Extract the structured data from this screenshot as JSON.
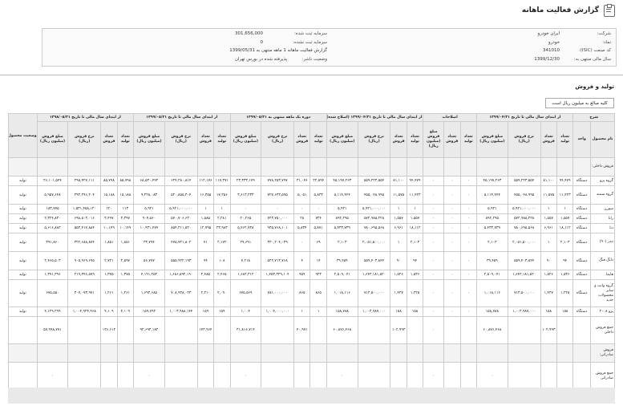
{
  "page": {
    "title": "گزارش فعالیت ماهانه"
  },
  "info": {
    "company_label": "شرکت:",
    "company_value": "ایران خودرو",
    "symbol_label": "نماد:",
    "symbol_value": "خودرو",
    "isic_label": "کد صنعت (ISIC):",
    "isic_value": "341010",
    "fiscal_label": "سال مالی منتهی به:",
    "fiscal_value": "1399/12/30",
    "reg_capital_label": "سرمایه ثبت شده:",
    "reg_capital_value": "301,656,000",
    "unreg_capital_label": "سرمایه ثبت نشده:",
    "unreg_capital_value": "0",
    "report_value": "گزارش فعالیت ماهانه 1 ماهه منتهی به 1399/05/31",
    "status_label": "وضعیت ناشر:",
    "status_value": "پذیرفته شده در بورس تهران"
  },
  "section": {
    "title": "تولید و فروش",
    "unit": "کلیه مبالغ به میلیون ریال است"
  },
  "table": {
    "group_headers": [
      "شرح",
      "از ابتدای سال مالی تا تاریخ ۱۳۹۹/۰۴/۳۱",
      "اصلاحات",
      "از ابتدای سال مالی تا تاریخ ۱۳۹۹/۰۴/۳۱ (اصلاح شده)",
      "دوره یک ماهه منتهی به ۱۳۹۹/۰۵/۳۱",
      "از ابتدای سال مالی تا تاریخ ۱۳۹۹/۰۵/۳۱",
      "از ابتدای سال مالی تا تاریخ ۱۳۹۸/۰۵/۳۱",
      "وضعیت محصول واحد"
    ],
    "sub_headers": [
      "نام محصول",
      "واحد",
      "تعداد تولید",
      "تعداد فروش",
      "نرخ فروش (ریال)",
      "مبلغ فروش (میلیون ریال)",
      "تعداد تولید",
      "تعداد فروش",
      "مبلغ فروش (میلیون ریال)",
      "تعداد تولید",
      "تعداد فروش",
      "نرخ فروش (ریال)",
      "مبلغ فروش (میلیون ریال)",
      "تعداد تولید",
      "تعداد فروش",
      "نرخ فروش (ریال)",
      "مبلغ فروش (میلیون ریال)",
      "تعداد تولید",
      "تعداد فروش",
      "نرخ فروش (ریال)",
      "مبلغ فروش (میلیون ریال)",
      "تعداد تولید",
      "تعداد فروش",
      "نرخ فروش (ریال)",
      "مبلغ فروش (میلیون ریال)",
      ""
    ],
    "rows": [
      {
        "kind": "sub",
        "h": 2,
        "cells": [
          "فروش داخلی:",
          "",
          "",
          "",
          "",
          "",
          "",
          "",
          "",
          "",
          "",
          "",
          "",
          "",
          "",
          "",
          "",
          "",
          "",
          "",
          "",
          "",
          "",
          "",
          "",
          ""
        ]
      },
      {
        "kind": "",
        "h": 1,
        "cells": [
          "گروه پژو",
          "دستگاه",
          "۹۴,۴۷۹",
          "۸۱,۱۰۰",
          "۵۵۹,۲۲۳,۵۵۴",
          "۴۵,۱۹۷,۲۶۳",
          "۰",
          "۰",
          "۰",
          "۹۴,۴۷۹",
          "۸۱,۱۰۰",
          "۵۵۹,۲۲۳,۵۵۴",
          "۴۵,۱۹۷,۲۶۳",
          "۲۲,۸۹۴",
          "۳۱,۰۷۶",
          "۷۷۸,۲۵۳,۷۹۷",
          "۲۳,۳۳۳,۱۷۹",
          "۱۱۷,۳۷۱",
          "۱۱۲,۱۷۶",
          "۶۲۴,۲۸۰,۸۱۴",
          "۶۸,۵۳۰,۴۴۲",
          "۸۵,۷۹۸",
          "۸۵,۷۹۸",
          "۲۹۵,۴۲۷,۱۱۱",
          "۲۶,۱۰۱,۵۴۴",
          "تولید"
        ]
      },
      {
        "kind": "",
        "h": 2,
        "cells": [
          "گروه سمند",
          "دستگاه",
          "۱۱,۴۲۳",
          "۱۱,۵۷۵",
          "۴۵۵,۰۴۸,۹۹۵",
          "۵,۱۱۴,۴۴۴",
          "۰",
          "۰",
          "۰",
          "۱۱,۴۲۳",
          "۱۱,۵۷۵",
          "۴۵۵,۰۴۸,۹۹۵",
          "۵,۱۱۴,۴۴۴",
          "۵,۸۳۳",
          "۵,۰۵۱",
          "۷۲۷,۶۳۲,۵۹۵",
          "۳,۶۱۳,۲۳۳",
          "۱۷,۲۵۶",
          "۱۶,۳۵۵",
          "۵۲۰,۸۵۵,۳۰۴",
          "۹,۲۲۸,۰۸۳",
          "۱۵,۱۸۸",
          "۱۵,۱۸۸",
          "۳۹۳,۲۹۶,۲۰۴",
          "۵,۹۵۷,۶۴۸",
          "تولید"
        ]
      },
      {
        "kind": "",
        "h": 1,
        "cells": [
          "سورن",
          "دستگاه",
          "۱",
          "۱",
          "۵,۹۲۱,۰۰۰,۰۰۰",
          "۵,۹۲۱",
          "۰",
          "۰",
          "۰",
          "۱",
          "۱",
          "۵,۹۲۱,۰۰۰,۰۰۰",
          "۵,۹۲۱",
          "۰",
          "۰",
          "۰",
          "۰",
          "۱",
          "۱",
          "۵,۹۲۱,۰۰۰,۰۰۰",
          "۵,۹۲۱",
          "۱۱۳",
          "۱۲۰",
          "۱,۵۳۱,۴۵۸,۱۲۰",
          "۱۸۳,۷۷۵",
          "تولید"
        ]
      },
      {
        "kind": "",
        "h": 1,
        "cells": [
          "رانا",
          "دستگاه",
          "۱,۵۵۷",
          "۱,۵۵۷",
          "۵۷۲,۹۸۵,۲۲۸",
          "۸۹۲,۲۹۵",
          "۰",
          "۰",
          "۰",
          "۱,۵۵۷",
          "۱,۵۵۷",
          "۵۷۲,۹۸۵,۲۲۸",
          "۸۹۲,۲۹۵",
          "۷۲۴",
          "۲۸",
          "۷۲۳,۷۵۰,۰۰۰",
          "۲۰,۲۶۵",
          "۲,۲۸۱",
          "۱,۵۸۵",
          "۵۷۰,۷۰۶,۶۳۰",
          "۹۰۴,۵۶۰",
          "۳,۳۹۷",
          "۳,۴۹۷",
          "۶۹۸,۵۰۳,۰۱۶",
          "۲,۳۲۴,۸۳۰",
          "تولید"
        ]
      },
      {
        "kind": "",
        "h": 1,
        "cells": [
          "دنا",
          "دستگاه",
          "۱۸,۱۱۲",
          "۶,۹۶۱",
          "۷۸۰,۶۹۵,۵۶۸",
          "۵,۴۳۳,۷۳۹",
          "۰",
          "۰",
          "۰",
          "۱۸,۱۱۲",
          "۶,۹۶۱",
          "۷۸۰,۶۹۵,۵۶۸",
          "۵,۴۳۳,۷۳۹",
          "۵,۸۷۱",
          "۵,۸۳۴",
          "۹۳۵,۷۶۸,۱۰۱",
          "۵,۴۶۲,۷۳۸",
          "۲۳,۹۸۳",
          "۱۲,۷۹۵",
          "۸۵۴,۳۱۱,۵۲۰",
          "۱۰,۹۳۱,۴۷۷",
          "۱۰,۱۴۹",
          "۱۰,۱۴۹",
          "۵۵۳,۴۱۷,۸۸۴",
          "۵,۶۱۶,۸۸۳",
          "تولید"
        ]
      },
      {
        "kind": "",
        "h": 2,
        "cells": [
          "تندر (۹۰)",
          "دستگاه",
          "۲,۱۰۳",
          "۱",
          "۲,۰۵۱,۵۰۰,۰۰۰",
          "۲,۱۰۳",
          "۰",
          "۰",
          "۰",
          "۲,۱۰۳",
          "۱",
          "۲,۰۵۱,۵۰۰,۰۰۰",
          "۲,۱۰۳",
          "۶۹",
          "۰",
          "۳۳۰,۲۰۴,۰۳۹",
          "۲۹,۶۹۱",
          "۲,۱۷۲",
          "۷۱",
          "۴۷۵,۷۲۱,۸۰۲",
          "۳۳,۷۹۴",
          "۱,۸۵۱",
          "۱,۸۵۱",
          "۳۲۲,۶۸۸,۸۷۴",
          "۳۹۱,۸۶۰",
          "تولید"
        ]
      },
      {
        "kind": "",
        "h": 2,
        "cells": [
          "دانگ فنگ",
          "دستگاه",
          "۹۴",
          "۹۰",
          "۵۵۹,۴۰۳,۸۴۴",
          "۳۹,۴۵۹",
          "۰",
          "۰",
          "۰",
          "۹۴",
          "۹۰",
          "۵۵۹,۴۰۳,۸۴۴",
          "۳۹,۴۵۹",
          "۱۴",
          "۴",
          "۵۲۲,۷۱۳,۷۶۸",
          "۷,۲۱۸",
          "۱۰۸",
          "۹۴",
          "۵۵۵,۹۲۲,۱۹۳",
          "۵۶,۷۷۷",
          "۲,۵۹۷",
          "۲,۷۲۱",
          "۹۰۵,۹۶۹,۶۹۵",
          "۲,۴۶۵,۵۰۳",
          "تولید"
        ]
      },
      {
        "kind": "",
        "h": 1,
        "cells": [
          "هایما",
          "دستگاه",
          "۱,۵۳۶",
          "۱,۵۲۶",
          "۱,۶۴۲,۱۸۱,۵۲۰",
          "۲,۵۰۹,۰۴۱",
          "۰",
          "۰",
          "۰",
          "۱,۵۳۶",
          "۱,۵۲۶",
          "۱,۶۴۳,۱۸۱,۵۲۰",
          "۲,۵۰۹,۰۴۱",
          "۹۲۳",
          "۹۵۹",
          "۱,۷۵۳,۳۲۹,۱۰۴",
          "۱,۶۸۲,۳۱۲",
          "۲,۴۶۵",
          "۲,۴۸۵",
          "۱,۶۸۶,۵۹۲,۱۹۰",
          "۴,۱۹۱,۲۵۳",
          "۱,۳۷۵",
          "۱,۳۷۵",
          "۲۱۹,۲۴۶,۵۷۹",
          "۱,۳۹۱,۳۹۶",
          "تولید"
        ]
      },
      {
        "kind": "",
        "h": 3,
        "cells": [
          "گروه وانت و سایر محصولات جدید",
          "دستگاه",
          "۱,۲۲۵",
          "۱,۴۲۷",
          "۷۱۳,۵۰۰,۰۰۰",
          "۱,۰۱۸,۱۱۶",
          "۰",
          "۰",
          "۰",
          "۱,۲۲۵",
          "۱,۴۲۷",
          "۷۱۳,۵۰۰,۰۰۰",
          "۱,۰۱۸,۱۱۶",
          "۸۶۵",
          "۸۶۵",
          "۷۸۱,۰۰۰,۰۰۰",
          "۶۷۵,۵۶۹",
          "۲,۰۹۰",
          "۲,۲۱۰",
          "۷۰۸,۹۳۸,۰۲۳",
          "۱,۶۹۳,۶۸۵",
          "۱,۲۶۱",
          "۱,۲۶۱",
          "۳۰۷,۰۷۳,۹۷۱",
          "۶۷۵,۵۵۰",
          "تولید"
        ]
      },
      {
        "kind": "",
        "h": 1,
        "cells": [
          "پژو ۲۰۰۸",
          "دستگاه",
          "۱۵۸",
          "۱۵۸",
          "۱,۰۰۳,۹۸۷,۰۰۰",
          "۱۵۸,۷۸۸",
          "۰",
          "۰",
          "۰",
          "۱۵۸",
          "۱۵۸",
          "۱,۰۰۳,۹۸۷,۰۰۰",
          "۱۵۸,۷۸۸",
          "۱",
          "۱",
          "۱,۰۰۴,۰۰۰,۰۰۰",
          "۱,۰۰۴",
          "۱۵۹",
          "۱۵۹",
          "۱,۰۰۳,۹۸۸,۱۴۴",
          "۱۵۹,۷۹۲",
          "۴,۱۰۹",
          "۴,۱۰۹",
          "۱,۰۰۴,۹۲۴,۴۶۸",
          "۴,۱۲۹,۲۹۹",
          "تولید"
        ]
      },
      {
        "kind": "",
        "h": 3,
        "cells": [
          "جمع فروش داخلی",
          "",
          "",
          "۱۰۲,۹۹۳",
          "",
          "۶۰,۸۷۶,۴۶۸",
          "",
          "",
          "۰",
          "",
          "۱۰۲,۹۹۳",
          "",
          "۶۰,۸۷۶,۴۶۸",
          "",
          "۴۰,۹۷۱",
          "",
          "۳۱,۸۱۶,۷۱۴",
          "",
          "۱۴۳,۹۶۴",
          "",
          "۹۲,۶۹۳,۱۸۲",
          "",
          "۱۲۶,۶۱۲",
          "",
          "۵۷,۹۹۸,۷۷۱",
          ""
        ]
      },
      {
        "kind": "sub",
        "h": 2,
        "cells": [
          "فروش صادراتی:",
          "",
          "",
          "",
          "",
          "",
          "",
          "",
          "",
          "",
          "",
          "",
          "",
          "",
          "",
          "",
          "",
          "",
          "",
          "",
          "",
          "",
          "",
          "",
          "",
          ""
        ]
      },
      {
        "kind": "",
        "h": 3,
        "cells": [
          "جمع فروش صادراتی",
          "",
          "",
          "",
          "",
          "۰",
          "",
          "",
          "۰",
          "",
          "",
          "",
          "۰",
          "",
          "",
          "",
          "۰",
          "",
          "",
          "",
          "۰",
          "",
          "",
          "",
          "۰",
          ""
        ]
      }
    ]
  }
}
